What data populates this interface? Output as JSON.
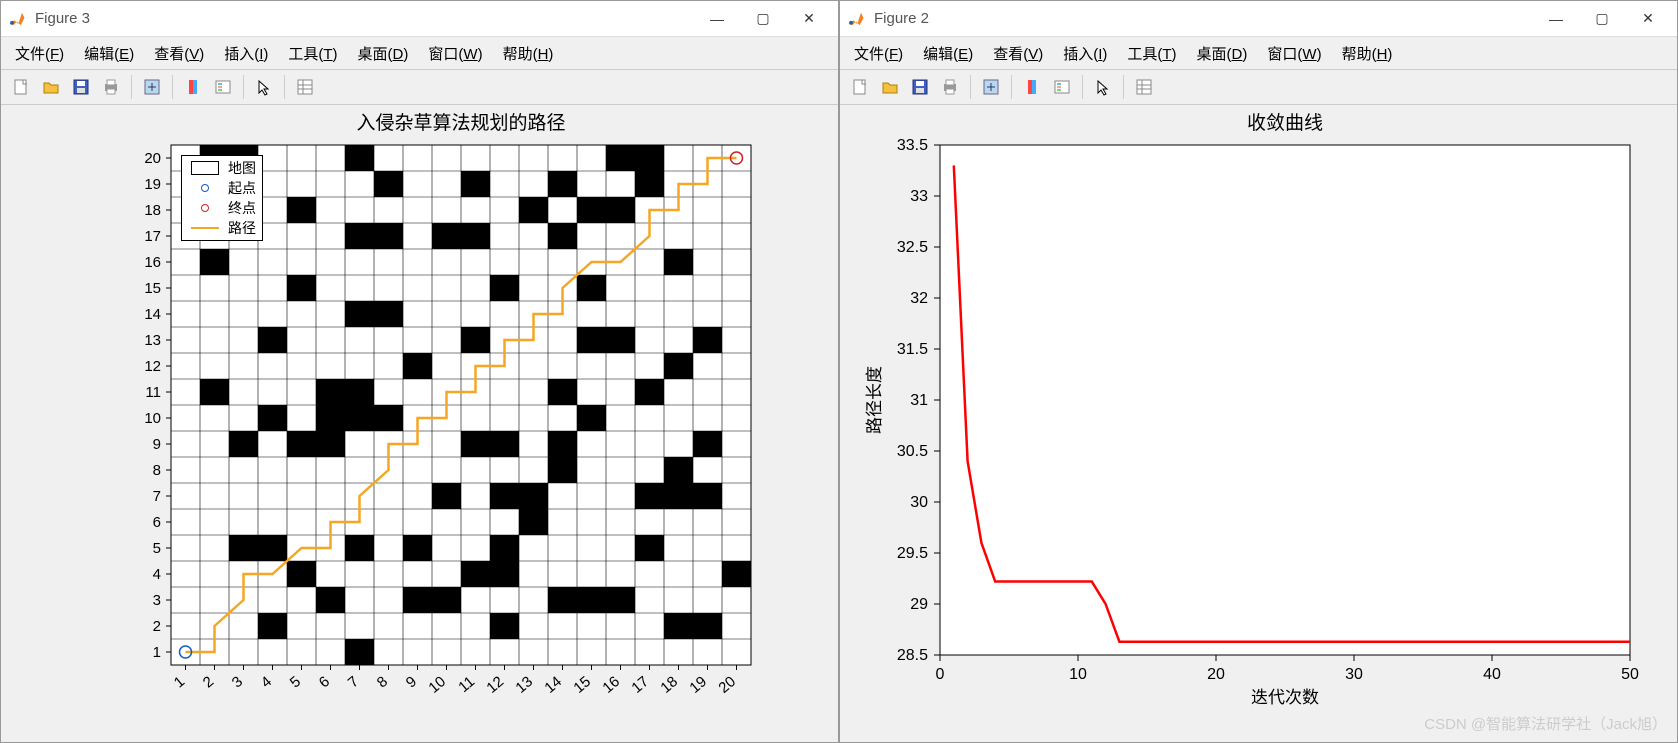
{
  "windows": [
    {
      "title": "Figure 3"
    },
    {
      "title": "Figure 2"
    }
  ],
  "menu": {
    "file": "文件(F)",
    "edit": "编辑(E)",
    "view": "查看(V)",
    "insert": "插入(I)",
    "tools": "工具(T)",
    "desktop": "桌面(D)",
    "window": "窗口(W)",
    "help": "帮助(H)"
  },
  "toolbar_icons": [
    "new-icon",
    "open-icon",
    "save-icon",
    "print-icon",
    "sep",
    "data-cursor-icon",
    "sep",
    "colorbar-icon",
    "legend-icon",
    "sep",
    "pointer-icon",
    "sep",
    "property-icon"
  ],
  "legend": {
    "map": "地图",
    "start": "起点",
    "end": "终点",
    "path": "路径"
  },
  "watermark": "CSDN @智能算法研学社（Jack旭）",
  "chart_data": [
    {
      "type": "heatmap",
      "title": "入侵杂草算法规划的路径",
      "xlabel": "",
      "ylabel": "",
      "xlim": [
        1,
        20
      ],
      "ylim": [
        1,
        20
      ],
      "x_ticks": [
        1,
        2,
        3,
        4,
        5,
        6,
        7,
        8,
        9,
        10,
        11,
        12,
        13,
        14,
        15,
        16,
        17,
        18,
        19,
        20
      ],
      "y_ticks": [
        1,
        2,
        3,
        4,
        5,
        6,
        7,
        8,
        9,
        10,
        11,
        12,
        13,
        14,
        15,
        16,
        17,
        18,
        19,
        20
      ],
      "obstacles": [
        [
          2,
          20
        ],
        [
          3,
          20
        ],
        [
          7,
          20
        ],
        [
          16,
          20
        ],
        [
          17,
          20
        ],
        [
          3,
          19
        ],
        [
          8,
          19
        ],
        [
          11,
          19
        ],
        [
          14,
          19
        ],
        [
          17,
          19
        ],
        [
          5,
          18
        ],
        [
          13,
          18
        ],
        [
          15,
          18
        ],
        [
          16,
          18
        ],
        [
          7,
          17
        ],
        [
          8,
          17
        ],
        [
          10,
          17
        ],
        [
          11,
          17
        ],
        [
          14,
          17
        ],
        [
          2,
          16
        ],
        [
          18,
          16
        ],
        [
          5,
          15
        ],
        [
          12,
          15
        ],
        [
          15,
          15
        ],
        [
          7,
          14
        ],
        [
          8,
          14
        ],
        [
          4,
          13
        ],
        [
          11,
          13
        ],
        [
          15,
          13
        ],
        [
          16,
          13
        ],
        [
          19,
          13
        ],
        [
          9,
          12
        ],
        [
          18,
          12
        ],
        [
          2,
          11
        ],
        [
          6,
          11
        ],
        [
          7,
          11
        ],
        [
          14,
          11
        ],
        [
          17,
          11
        ],
        [
          4,
          10
        ],
        [
          6,
          10
        ],
        [
          7,
          10
        ],
        [
          8,
          10
        ],
        [
          15,
          10
        ],
        [
          3,
          9
        ],
        [
          5,
          9
        ],
        [
          6,
          9
        ],
        [
          11,
          9
        ],
        [
          12,
          9
        ],
        [
          14,
          9
        ],
        [
          19,
          9
        ],
        [
          14,
          8
        ],
        [
          18,
          8
        ],
        [
          10,
          7
        ],
        [
          12,
          7
        ],
        [
          13,
          7
        ],
        [
          13,
          6
        ],
        [
          17,
          7
        ],
        [
          18,
          7
        ],
        [
          19,
          7
        ],
        [
          3,
          5
        ],
        [
          4,
          5
        ],
        [
          7,
          5
        ],
        [
          9,
          5
        ],
        [
          12,
          5
        ],
        [
          17,
          5
        ],
        [
          5,
          4
        ],
        [
          11,
          4
        ],
        [
          12,
          4
        ],
        [
          20,
          4
        ],
        [
          6,
          3
        ],
        [
          9,
          3
        ],
        [
          10,
          3
        ],
        [
          14,
          3
        ],
        [
          15,
          3
        ],
        [
          16,
          3
        ],
        [
          4,
          2
        ],
        [
          12,
          2
        ],
        [
          18,
          2
        ],
        [
          19,
          2
        ],
        [
          7,
          1
        ]
      ],
      "start": [
        1,
        1
      ],
      "end": [
        20,
        20
      ],
      "path": [
        [
          1,
          1
        ],
        [
          2,
          1
        ],
        [
          2,
          2
        ],
        [
          3,
          3
        ],
        [
          3,
          4
        ],
        [
          4,
          4
        ],
        [
          5,
          5
        ],
        [
          6,
          5
        ],
        [
          6,
          6
        ],
        [
          7,
          6
        ],
        [
          7,
          7
        ],
        [
          8,
          8
        ],
        [
          8,
          9
        ],
        [
          9,
          9
        ],
        [
          9,
          10
        ],
        [
          10,
          10
        ],
        [
          10,
          11
        ],
        [
          11,
          11
        ],
        [
          11,
          12
        ],
        [
          12,
          12
        ],
        [
          12,
          13
        ],
        [
          13,
          13
        ],
        [
          13,
          14
        ],
        [
          14,
          14
        ],
        [
          14,
          15
        ],
        [
          15,
          16
        ],
        [
          16,
          16
        ],
        [
          17,
          17
        ],
        [
          17,
          18
        ],
        [
          18,
          18
        ],
        [
          18,
          19
        ],
        [
          19,
          19
        ],
        [
          19,
          20
        ],
        [
          20,
          20
        ]
      ],
      "legend": [
        "地图",
        "起点",
        "终点",
        "路径"
      ]
    },
    {
      "type": "line",
      "title": "收敛曲线",
      "xlabel": "迭代次数",
      "ylabel": "路径长度",
      "xlim": [
        0,
        50
      ],
      "ylim": [
        28.5,
        33.5
      ],
      "x_ticks": [
        0,
        10,
        20,
        30,
        40,
        50
      ],
      "y_ticks": [
        28.5,
        29,
        29.5,
        30,
        30.5,
        31,
        31.5,
        32,
        32.5,
        33,
        33.5
      ],
      "series": [
        {
          "name": "",
          "color": "#ff0000",
          "x": [
            1,
            2,
            3,
            4,
            5,
            6,
            7,
            8,
            9,
            10,
            11,
            12,
            13,
            14,
            15,
            20,
            25,
            30,
            35,
            40,
            45,
            50
          ],
          "values": [
            33.3,
            30.4,
            29.6,
            29.22,
            29.22,
            29.22,
            29.22,
            29.22,
            29.22,
            29.22,
            29.22,
            29.0,
            28.63,
            28.63,
            28.63,
            28.63,
            28.63,
            28.63,
            28.63,
            28.63,
            28.63,
            28.63
          ]
        }
      ]
    }
  ]
}
